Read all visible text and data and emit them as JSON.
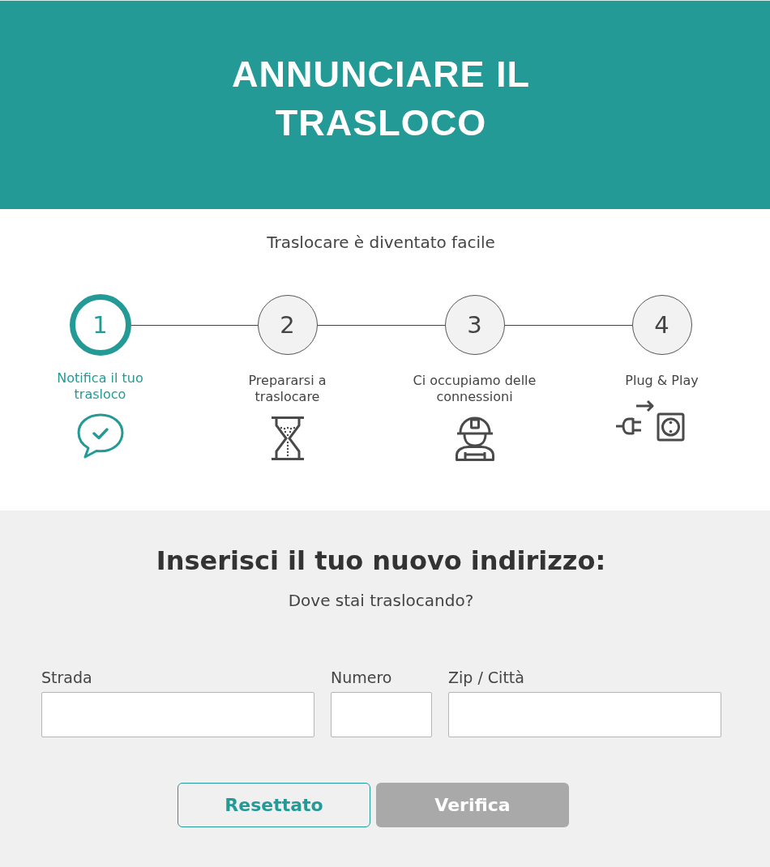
{
  "header": {
    "title": "ANNUNCIARE IL TRASLOCO"
  },
  "intro": {
    "subtitle": "Traslocare è diventato facile"
  },
  "steps": [
    {
      "number": "1",
      "label": "Notifica il tuo trasloco",
      "selected": true
    },
    {
      "number": "2",
      "label": "Prepararsi a traslocare",
      "selected": false
    },
    {
      "number": "3",
      "label": "Ci occupiamo delle connessioni",
      "selected": false
    },
    {
      "number": "4",
      "label": "Plug & Play",
      "selected": false
    }
  ],
  "address_form": {
    "heading": "Inserisci il tuo nuovo indirizzo:",
    "subheading": "Dove stai traslocando?",
    "fields": [
      {
        "label": "Strada"
      },
      {
        "label": "Numero"
      },
      {
        "label": "Zip / Città"
      }
    ],
    "buttons": [
      {
        "label": "Resettato",
        "kind": "outline",
        "disabled": false
      },
      {
        "label": "Verifica",
        "kind": "primary",
        "disabled": true
      }
    ]
  }
}
